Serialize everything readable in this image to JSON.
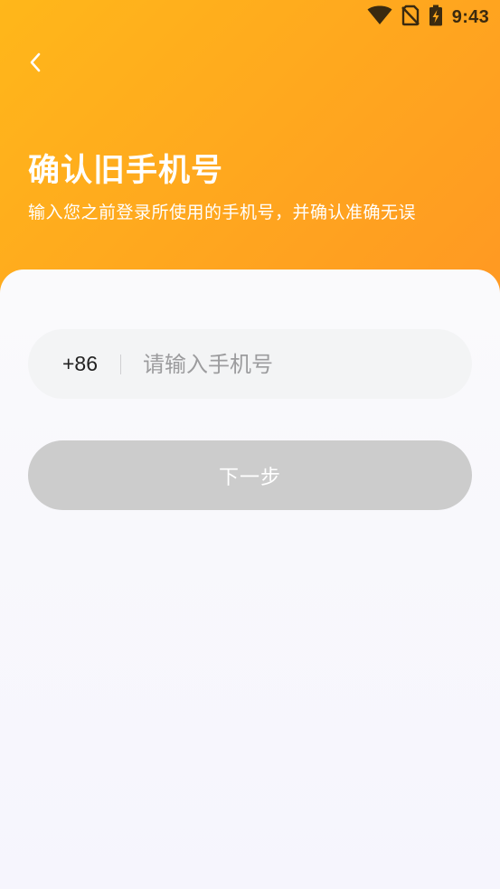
{
  "status_bar": {
    "time": "9:43",
    "icons": [
      "wifi-icon",
      "no-sim-icon",
      "battery-charging-icon"
    ]
  },
  "header": {
    "back_icon": "chevron-left-icon",
    "title": "确认旧手机号",
    "subtitle": "输入您之前登录所使用的手机号，并确认准确无误"
  },
  "form": {
    "country_code": "+86",
    "phone": {
      "value": "",
      "placeholder": "请输入手机号"
    },
    "next_button_label": "下一步"
  },
  "colors": {
    "header_gradient_start": "#ffb71a",
    "header_gradient_end": "#ff8e1f",
    "card_background": "#f7f6fc",
    "input_background": "#f3f4f5",
    "button_disabled": "#cccccc"
  }
}
